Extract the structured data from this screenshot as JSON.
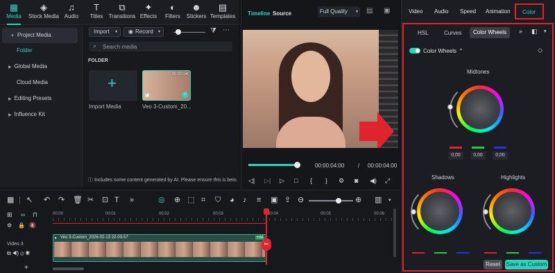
{
  "top_tabs": [
    {
      "label": "Media",
      "icon": "media-icon",
      "glyph": "▦"
    },
    {
      "label": "Stock Media",
      "icon": "stock-media-icon",
      "glyph": "◈"
    },
    {
      "label": "Audio",
      "icon": "audio-icon",
      "glyph": "♫"
    },
    {
      "label": "Titles",
      "icon": "titles-icon",
      "glyph": "T"
    },
    {
      "label": "Transitions",
      "icon": "transitions-icon",
      "glyph": "⧉"
    },
    {
      "label": "Effects",
      "icon": "effects-icon",
      "glyph": "✦"
    },
    {
      "label": "Filters",
      "icon": "filters-icon",
      "glyph": "◐"
    },
    {
      "label": "Stickers",
      "icon": "stickers-icon",
      "glyph": "☻"
    },
    {
      "label": "Templates",
      "icon": "templates-icon",
      "glyph": "▤"
    }
  ],
  "sidebar": {
    "items": [
      {
        "label": "Project Media",
        "caret": "▼"
      },
      {
        "label": "Folder",
        "caret": ""
      },
      {
        "label": "Global Media",
        "caret": "▶"
      },
      {
        "label": "Cloud Media",
        "caret": ""
      },
      {
        "label": "Editing Presets",
        "caret": "▶"
      },
      {
        "label": "Influence Kit",
        "caret": "▶"
      }
    ]
  },
  "media": {
    "import_label": "Import",
    "record_label": "Record",
    "search_placeholder": "Search media",
    "folder_label": "FOLDER",
    "import_media_label": "Import Media",
    "clip_name": "Veo 3-Custom_20...",
    "clip_duration": "00:00:04",
    "ai_notice": "Includes some content generated by AI. Please ensure this is bein."
  },
  "preview": {
    "timeline_tab": "Timeline",
    "source_tab": "Source",
    "quality": "Full Quality",
    "current_time": "00:00:04:00",
    "separator": "/",
    "total_time": "00:00:04:00",
    "progress": 1.0
  },
  "right_panel": {
    "tabs": [
      "Video",
      "Audio",
      "Speed",
      "Animation",
      "Color"
    ],
    "active_tab": "Color",
    "sub_tabs": [
      "HSL",
      "Curves",
      "Color Wheels"
    ],
    "active_sub_tab": "Color Wheels",
    "color_wheels_label": "Color Wheels",
    "midtones_label": "Midtones",
    "shadows_label": "Shadows",
    "highlights_label": "Highlights",
    "values": [
      "0,00",
      "0,00",
      "0,00"
    ],
    "reset_label": "Reset",
    "save_custom_label": "Save as Custom"
  },
  "timeline": {
    "ruler_labels": [
      "00:00",
      "00:01",
      "00:02",
      "00:03",
      "00:04",
      "00:05",
      "00:06"
    ],
    "track_label": "Video 3",
    "clip_title": "Veo 3-Custom_2026-02-13 22-03-57",
    "ai_badge": "+AI",
    "add_label": "+"
  },
  "colors": {
    "accent": "#28d6c0",
    "highlight_red": "#e0242e"
  }
}
